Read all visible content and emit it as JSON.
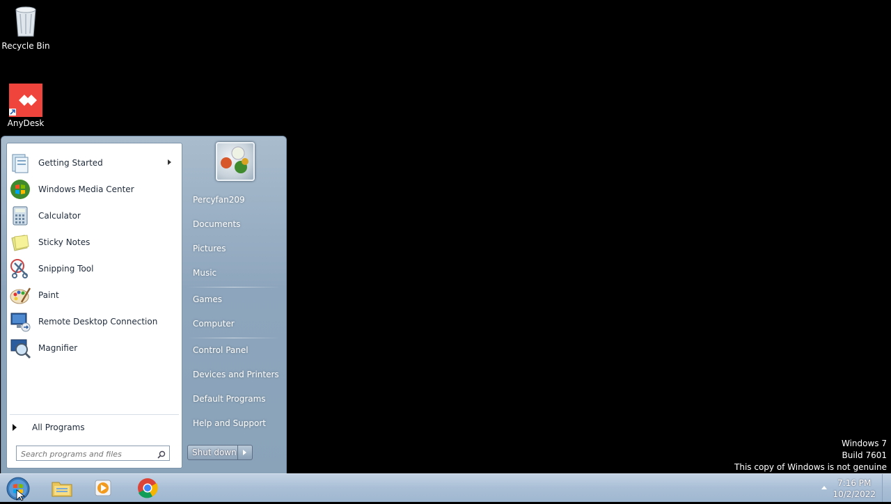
{
  "desktop": {
    "icons": [
      {
        "label": "Recycle Bin"
      },
      {
        "label": "AnyDesk"
      }
    ]
  },
  "start_menu": {
    "programs": [
      {
        "label": "Getting Started",
        "has_submenu": true
      },
      {
        "label": "Windows Media Center"
      },
      {
        "label": "Calculator"
      },
      {
        "label": "Sticky Notes"
      },
      {
        "label": "Snipping Tool"
      },
      {
        "label": "Paint"
      },
      {
        "label": "Remote Desktop Connection"
      },
      {
        "label": "Magnifier"
      }
    ],
    "all_programs": "All Programs",
    "search_placeholder": "Search programs and files",
    "right": {
      "user": "Percyfan209",
      "documents": "Documents",
      "pictures": "Pictures",
      "music": "Music",
      "games": "Games",
      "computer": "Computer",
      "control_panel": "Control Panel",
      "devices_printers": "Devices and Printers",
      "default_programs": "Default Programs",
      "help_support": "Help and Support"
    },
    "shutdown_label": "Shut down"
  },
  "taskbar": {
    "time": "7:16 PM",
    "date": "10/2/2022"
  },
  "watermark": {
    "line1": "Windows 7",
    "line2": "Build 7601",
    "line3": "This copy of Windows is not genuine"
  },
  "colors": {
    "desktop_bg": "#000000",
    "anydesk_red": "#ef443b",
    "taskbar": "#a9bfd6"
  }
}
